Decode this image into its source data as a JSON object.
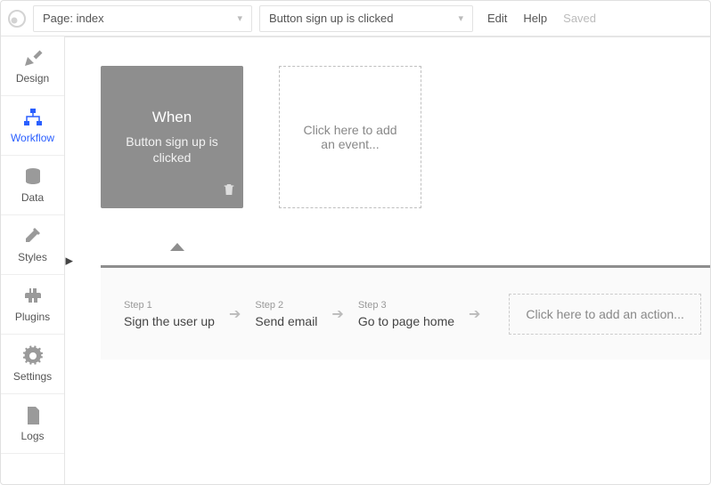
{
  "topbar": {
    "page_dropdown_label": "Page: index",
    "workflow_dropdown_label": "Button sign up is clicked",
    "edit": "Edit",
    "help": "Help",
    "saved": "Saved"
  },
  "sidebar": {
    "items": [
      {
        "key": "design",
        "label": "Design"
      },
      {
        "key": "workflow",
        "label": "Workflow"
      },
      {
        "key": "data",
        "label": "Data"
      },
      {
        "key": "styles",
        "label": "Styles"
      },
      {
        "key": "plugins",
        "label": "Plugins"
      },
      {
        "key": "settings",
        "label": "Settings"
      },
      {
        "key": "logs",
        "label": "Logs"
      }
    ],
    "active_key": "workflow"
  },
  "canvas": {
    "event_card": {
      "when_label": "When",
      "condition": "Button sign up is clicked"
    },
    "add_event_text": "Click here to add an event...",
    "steps": [
      {
        "num": "Step 1",
        "title": "Sign the user up"
      },
      {
        "num": "Step 2",
        "title": "Send email"
      },
      {
        "num": "Step 3",
        "title": "Go to page home"
      }
    ],
    "add_action_text": "Click here to add an action..."
  }
}
